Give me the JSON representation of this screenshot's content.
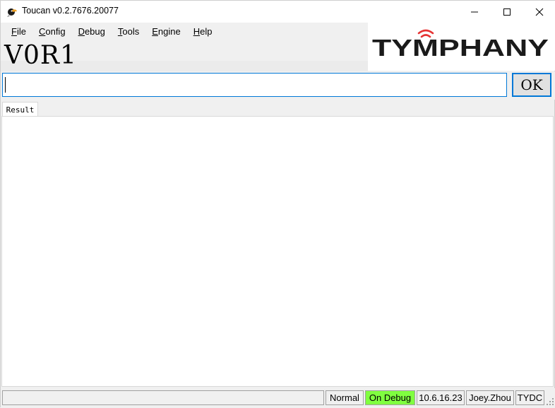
{
  "window": {
    "title": "Toucan v0.2.7676.20077",
    "app_icon": "toucan-icon",
    "controls": [
      "minimize-icon",
      "maximize-icon",
      "close-icon"
    ]
  },
  "menu": {
    "items": [
      {
        "label": "File",
        "underline": "F",
        "rest": "ile"
      },
      {
        "label": "Config",
        "underline": "C",
        "rest": "onfig"
      },
      {
        "label": "Debug",
        "underline": "D",
        "rest": "ebug"
      },
      {
        "label": "Tools",
        "underline": "T",
        "rest": "ools"
      },
      {
        "label": "Engine",
        "underline": "E",
        "rest": "ngine"
      },
      {
        "label": "Help",
        "underline": "H",
        "rest": "elp"
      }
    ]
  },
  "header": {
    "big_title": "V0R1",
    "logo_text": "TYMPHANY"
  },
  "command": {
    "value": "",
    "ok_label": "OK"
  },
  "tabs": [
    {
      "label": "Result",
      "selected": true
    }
  ],
  "status": {
    "empty": "",
    "mode": "Normal",
    "debug": "On Debug",
    "version": "10.6.16.23",
    "user": "Joey.Zhou",
    "site": "TYDC",
    "debug_color": "#80ff40"
  },
  "colors": {
    "accent": "#0078d7",
    "logo_red": "#e63232"
  }
}
